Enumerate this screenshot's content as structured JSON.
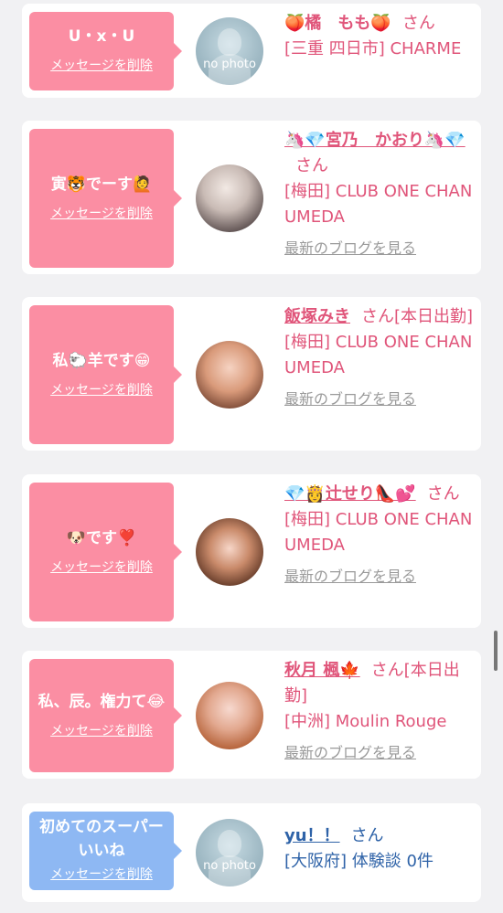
{
  "cards": [
    {
      "message": "U・x・U",
      "delete_label": "メッセージを削除",
      "avatar_label": "no photo",
      "name": "🍑橘　もも🍑",
      "honorific": "さん",
      "shop": "[三重 四日市] CHARME",
      "blog_label": ""
    },
    {
      "message": "寅🐯でーす🙋",
      "delete_label": "メッセージを削除",
      "name": "🦄💎宮乃　かおり🦄💎",
      "honorific": "さん",
      "shop": "[梅田] CLUB ONE CHAN UMEDA",
      "blog_label": "最新のブログを見る"
    },
    {
      "message": "私🐑羊です😁",
      "delete_label": "メッセージを削除",
      "name": "飯塚みき",
      "honorific": "さん[本日出勤]",
      "shop": "[梅田] CLUB ONE CHAN UMEDA",
      "blog_label": "最新のブログを見る"
    },
    {
      "message": "🐶です❣️",
      "delete_label": "メッセージを削除",
      "name": "💎👸辻せり👠💕",
      "honorific": "さん",
      "shop": "[梅田] CLUB ONE CHAN UMEDA",
      "blog_label": "最新のブログを見る"
    },
    {
      "message": "私、辰。権力て😂",
      "delete_label": "メッセージを削除",
      "name": "秋月 楓🍁",
      "honorific": "さん[本日出勤]",
      "shop": "[中洲] Moulin Rouge",
      "blog_label": "最新のブログを見る"
    },
    {
      "message": "初めてのスーパーいいね",
      "delete_label": "メッセージを削除",
      "avatar_label": "no photo",
      "name": "yu！！",
      "honorific": "さん",
      "shop": "[大阪府] 体験談 0件",
      "blog_label": ""
    }
  ],
  "colors": {
    "pink_bubble": "#fb8ea3",
    "blue_bubble": "#8eb8f3",
    "name_pink": "#e0557a",
    "name_blue": "#2f63a8",
    "background": "#f1f1f3"
  }
}
